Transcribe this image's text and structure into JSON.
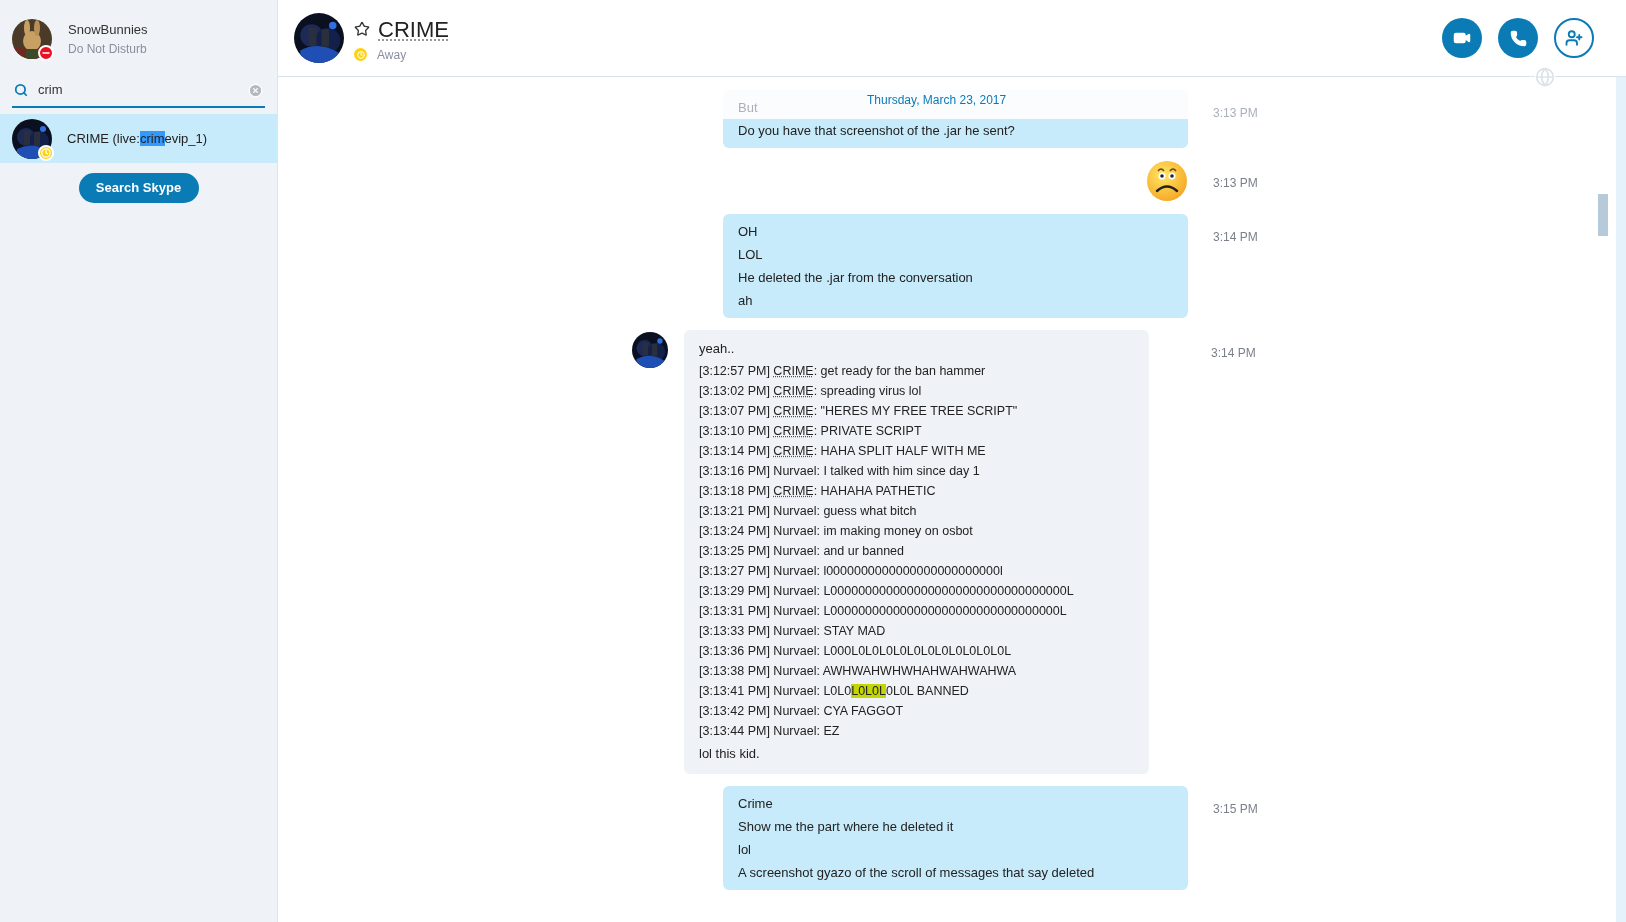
{
  "profile": {
    "name": "SnowBunnies",
    "status": "Do Not Disturb",
    "badge": {
      "kind": "dnd"
    }
  },
  "search": {
    "value": "crim"
  },
  "results": [
    {
      "before": "CRIME (live:",
      "match": "crim",
      "after": "evip_1)",
      "badge": {
        "kind": "away"
      },
      "selected": true
    }
  ],
  "search_button": "Search Skype",
  "contact": {
    "name": "CRIME",
    "status": "Away",
    "badge": {
      "kind": "away"
    },
    "favorite": false
  },
  "date_divider": "Thursday, March 23, 2017",
  "messages": [
    {
      "kind": "outgoing",
      "faded": true,
      "time": "3:13 PM",
      "lines": [
        "But",
        "Do you have that screenshot of the .jar he sent?"
      ]
    },
    {
      "kind": "emoticon",
      "time": "3:13 PM"
    },
    {
      "kind": "outgoing",
      "faded": false,
      "time": "3:14 PM",
      "lines": [
        "OH",
        "LOL",
        "He deleted the .jar from the conversation",
        "ah"
      ]
    },
    {
      "kind": "incoming",
      "time": "3:14 PM",
      "intro": "yeah..",
      "outro": "lol this kid.",
      "log": [
        {
          "prefix": "[3:12:57 PM] ",
          "sender": "CRIME",
          "mention": true,
          "body": ": get ready for the ban hammer"
        },
        {
          "prefix": "[3:13:02 PM] ",
          "sender": "CRIME",
          "mention": true,
          "body": ": spreading virus lol"
        },
        {
          "prefix": "[3:13:07 PM] ",
          "sender": "CRIME",
          "mention": true,
          "body": ": \"HERES MY FREE TREE SCRIPT\""
        },
        {
          "prefix": "[3:13:10 PM] ",
          "sender": "CRIME",
          "mention": true,
          "body": ": PRIVATE SCRIPT"
        },
        {
          "prefix": "[3:13:14 PM] ",
          "sender": "CRIME",
          "mention": true,
          "body": ": HAHA SPLIT HALF WITH ME"
        },
        {
          "prefix": "[3:13:16 PM] ",
          "sender": "Nurvael",
          "mention": false,
          "body": ": I talked with him since day 1"
        },
        {
          "prefix": "[3:13:18 PM] ",
          "sender": "CRIME",
          "mention": true,
          "body": ": HAHAHA PATHETIC"
        },
        {
          "prefix": "[3:13:21 PM] ",
          "sender": "Nurvael",
          "mention": false,
          "body": ": guess what bitch"
        },
        {
          "prefix": "[3:13:24 PM] ",
          "sender": "Nurvael",
          "mention": false,
          "body": ": im making money on osbot"
        },
        {
          "prefix": "[3:13:25 PM] ",
          "sender": "Nurvael",
          "mention": false,
          "body": ": and ur banned"
        },
        {
          "prefix": "[3:13:27 PM] ",
          "sender": "Nurvael",
          "mention": false,
          "body": ": l0000000000000000000000000l"
        },
        {
          "prefix": "[3:13:29 PM] ",
          "sender": "Nurvael",
          "mention": false,
          "body": ": L0000000000000000000000000000000000L"
        },
        {
          "prefix": "[3:13:31 PM] ",
          "sender": "Nurvael",
          "mention": false,
          "body": ": L000000000000000000000000000000000L"
        },
        {
          "prefix": "[3:13:33 PM] ",
          "sender": "Nurvael",
          "mention": false,
          "body": ": STAY MAD"
        },
        {
          "prefix": "[3:13:36 PM] ",
          "sender": "Nurvael",
          "mention": false,
          "body": ": L000L0L0L0L0L0L0L0L0L0L0L0L"
        },
        {
          "prefix": "[3:13:38 PM] ",
          "sender": "Nurvael",
          "mention": false,
          "body": ": AWHWAHWHWHAHWAHWAHWA"
        },
        {
          "prefix": "[3:13:41 PM] ",
          "sender": "Nurvael",
          "mention": false,
          "body": ": L0L0",
          "match": "L0L0L",
          "after": "0L0L BANNED"
        },
        {
          "prefix": "[3:13:42 PM] ",
          "sender": "Nurvael",
          "mention": false,
          "body": ": CYA FAGGOT"
        },
        {
          "prefix": "[3:13:44 PM] ",
          "sender": "Nurvael",
          "mention": false,
          "body": ": EZ"
        }
      ]
    },
    {
      "kind": "outgoing",
      "faded": false,
      "time": "3:15 PM",
      "lines": [
        "Crime",
        "Show me the part where he deleted it",
        "lol",
        "A screenshot gyazo of the scroll of messages that say deleted"
      ]
    }
  ]
}
